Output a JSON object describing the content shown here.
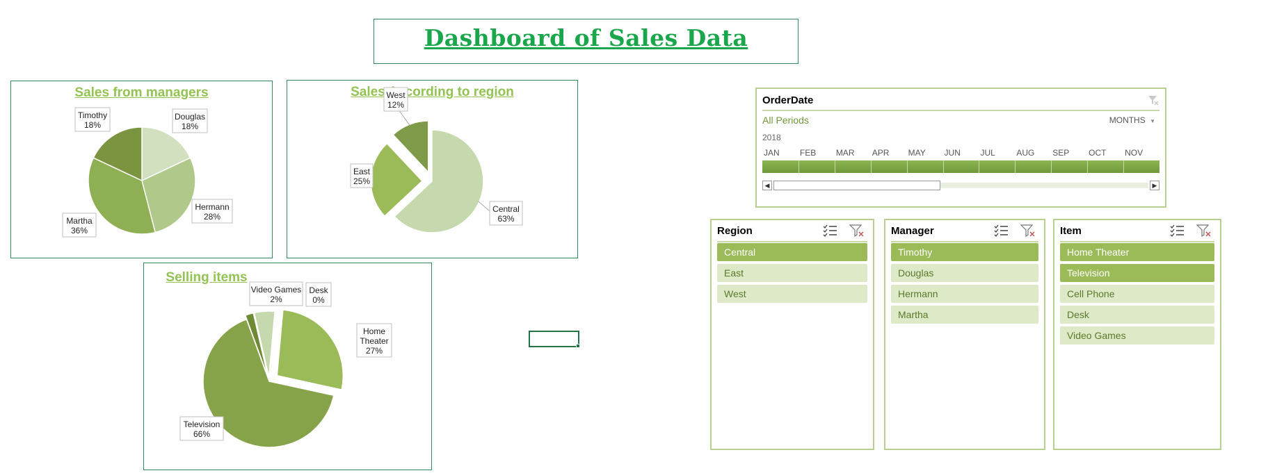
{
  "dashboard": {
    "title": "Dashboard of Sales Data"
  },
  "charts": {
    "managers": {
      "title": "Sales from managers"
    },
    "region": {
      "title": "Sales According to region"
    },
    "items": {
      "title": "Selling items"
    }
  },
  "chart_data": [
    {
      "type": "pie",
      "title": "Sales from managers",
      "categories": [
        "Douglas",
        "Hermann",
        "Martha",
        "Timothy"
      ],
      "values": [
        18,
        28,
        36,
        18
      ],
      "labels": [
        "18%",
        "28%",
        "36%",
        "18%"
      ],
      "colors": [
        "#d3e0c0",
        "#b0c98a",
        "#8faf55",
        "#7a9440"
      ]
    },
    {
      "type": "pie",
      "title": "Sales According to region",
      "categories": [
        "Central",
        "East",
        "West"
      ],
      "values": [
        63,
        25,
        12
      ],
      "labels": [
        "63%",
        "25%",
        "12%"
      ],
      "colors": [
        "#c6d9ae",
        "#9bbb59",
        "#7f9a48"
      ]
    },
    {
      "type": "pie",
      "title": "Selling items",
      "categories": [
        "Home Theater",
        "Television",
        "Video Games",
        "Desk",
        "Cell Phone"
      ],
      "label_lines": [
        [
          "Home",
          "Theater"
        ],
        [
          "Television"
        ],
        [
          "Video Games"
        ],
        [
          "Desk"
        ],
        [
          ""
        ]
      ],
      "values": [
        27,
        66,
        2,
        0,
        5
      ],
      "labels": [
        "27%",
        "66%",
        "2%",
        "0%",
        ""
      ],
      "colors": [
        "#9bbb59",
        "#87a34a",
        "#6f8a35",
        "#e6eed8",
        "#c6d9ae"
      ]
    }
  ],
  "timeline": {
    "header": "OrderDate",
    "periods_label": "All Periods",
    "level_label": "MONTHS",
    "year": "2018",
    "months": [
      "JAN",
      "FEB",
      "MAR",
      "APR",
      "MAY",
      "JUN",
      "JUL",
      "AUG",
      "SEP",
      "OCT",
      "NOV"
    ]
  },
  "slicers": [
    {
      "title": "Region",
      "items": [
        {
          "label": "Central",
          "selected": true
        },
        {
          "label": "East",
          "selected": false
        },
        {
          "label": "West",
          "selected": false
        }
      ]
    },
    {
      "title": "Manager",
      "items": [
        {
          "label": "Timothy",
          "selected": true
        },
        {
          "label": "Douglas",
          "selected": false
        },
        {
          "label": "Hermann",
          "selected": false
        },
        {
          "label": "Martha",
          "selected": false
        }
      ]
    },
    {
      "title": "Item",
      "items": [
        {
          "label": "Home Theater",
          "selected": true
        },
        {
          "label": "Television",
          "selected": true
        },
        {
          "label": "Cell Phone",
          "selected": false
        },
        {
          "label": "Desk",
          "selected": false
        },
        {
          "label": "Video Games",
          "selected": false
        }
      ]
    }
  ]
}
